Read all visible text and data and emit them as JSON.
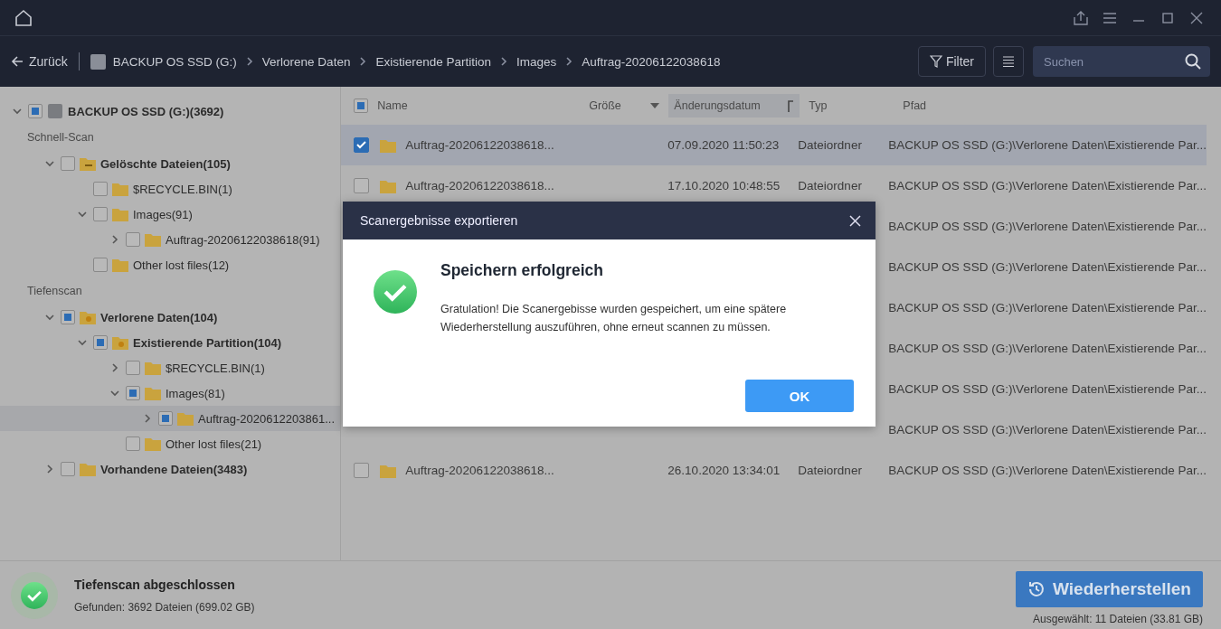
{
  "breadcrumb": {
    "back": "Zurück",
    "crumbs": [
      "BACKUP OS SSD (G:)",
      "Verlorene Daten",
      "Existierende Partition",
      "Images",
      "Auftrag-20206122038618"
    ]
  },
  "toolbar": {
    "filter": "Filter",
    "search": {
      "placeholder": "Suchen"
    }
  },
  "tree": {
    "root": {
      "label": "BACKUP OS SSD (G:)(3692)",
      "partial": true,
      "expandable": true,
      "expanded": true,
      "kind": "drive",
      "bold": true,
      "selected": false
    },
    "sections": [
      {
        "label": "Schnell-Scan",
        "items": [
          {
            "label": "Gelöschte Dateien(105)",
            "partial": false,
            "expandable": true,
            "expanded": true,
            "kind": "deleted",
            "bold": true,
            "selected": false,
            "children": [
              {
                "label": "$RECYCLE.BIN(1)",
                "partial": false,
                "expandable": false,
                "kind": "folder",
                "bold": false,
                "selected": false
              },
              {
                "label": "Images(91)",
                "partial": false,
                "expandable": true,
                "expanded": true,
                "kind": "folder",
                "bold": false,
                "selected": false,
                "children": [
                  {
                    "label": "Auftrag-20206122038618(91)",
                    "partial": false,
                    "expandable": true,
                    "expanded": false,
                    "kind": "folder",
                    "bold": false,
                    "selected": false
                  }
                ]
              },
              {
                "label": "Other lost files(12)",
                "partial": false,
                "expandable": false,
                "kind": "folder",
                "bold": false,
                "selected": false
              }
            ]
          }
        ]
      },
      {
        "label": "Tiefenscan",
        "items": [
          {
            "label": "Verlorene Daten(104)",
            "partial": true,
            "expandable": true,
            "expanded": true,
            "kind": "lost",
            "bold": true,
            "selected": false,
            "children": [
              {
                "label": "Existierende Partition(104)",
                "partial": true,
                "expandable": true,
                "expanded": true,
                "kind": "lost",
                "bold": true,
                "selected": false,
                "children": [
                  {
                    "label": "$RECYCLE.BIN(1)",
                    "partial": false,
                    "expandable": true,
                    "expanded": false,
                    "kind": "folder",
                    "bold": false,
                    "selected": false
                  },
                  {
                    "label": "Images(81)",
                    "partial": true,
                    "expandable": true,
                    "expanded": true,
                    "kind": "folder",
                    "bold": false,
                    "selected": false,
                    "children": [
                      {
                        "label": "Auftrag-2020612203861...",
                        "partial": true,
                        "expandable": true,
                        "expanded": false,
                        "kind": "folder",
                        "bold": false,
                        "selected": true
                      }
                    ]
                  },
                  {
                    "label": "Other lost files(21)",
                    "partial": false,
                    "expandable": false,
                    "kind": "folder",
                    "bold": false,
                    "selected": false
                  }
                ]
              }
            ]
          },
          {
            "label": "Vorhandene Dateien(3483)",
            "partial": false,
            "expandable": true,
            "expanded": false,
            "kind": "folder",
            "bold": true,
            "selected": false
          }
        ]
      }
    ]
  },
  "table": {
    "all_partial": true,
    "columns": [
      {
        "label": "Name",
        "sorted": false,
        "caret": false
      },
      {
        "label": "Größe",
        "sorted": false,
        "caret": true
      },
      {
        "label": "Änderungsdatum",
        "sorted": true,
        "caret": false
      },
      {
        "label": "Typ",
        "sorted": false,
        "caret": false
      },
      {
        "label": "Pfad",
        "sorted": false,
        "caret": false
      }
    ],
    "rows": [
      {
        "kind": "full",
        "name": "Auftrag-20206122038618...",
        "date": "07.09.2020 11:50:23",
        "type": "Dateiordner",
        "path": "BACKUP OS SSD (G:)\\Verlorene Daten\\Existierende Par...",
        "checked": true,
        "selected": true
      },
      {
        "kind": "full",
        "name": "Auftrag-20206122038618...",
        "date": "17.10.2020 10:48:55",
        "type": "Dateiordner",
        "path": "BACKUP OS SSD (G:)\\Verlorene Daten\\Existierende Par...",
        "checked": false,
        "selected": false
      },
      {
        "kind": "path_only",
        "path": "BACKUP OS SSD (G:)\\Verlorene Daten\\Existierende Par..."
      },
      {
        "kind": "path_only",
        "path": "BACKUP OS SSD (G:)\\Verlorene Daten\\Existierende Par..."
      },
      {
        "kind": "path_only",
        "path": "BACKUP OS SSD (G:)\\Verlorene Daten\\Existierende Par..."
      },
      {
        "kind": "path_only",
        "path": "BACKUP OS SSD (G:)\\Verlorene Daten\\Existierende Par..."
      },
      {
        "kind": "path_only",
        "path": "BACKUP OS SSD (G:)\\Verlorene Daten\\Existierende Par..."
      },
      {
        "kind": "path_only",
        "path": "BACKUP OS SSD (G:)\\Verlorene Daten\\Existierende Par..."
      },
      {
        "kind": "full",
        "name": "Auftrag-20206122038618...",
        "date": "26.10.2020 13:34:01",
        "type": "Dateiordner",
        "path": "BACKUP OS SSD (G:)\\Verlorene Daten\\Existierende Par...",
        "checked": false,
        "selected": false
      }
    ]
  },
  "status": {
    "title": "Tiefenscan abgeschlossen",
    "detail": "Gefunden: 3692 Dateien (699.02 GB)",
    "recover": "Wiederherstellen",
    "selection": "Ausgewählt: 11 Dateien (33.81 GB)"
  },
  "dialog": {
    "title": "Scanergebnisse exportieren",
    "heading": "Speichern erfolgreich",
    "message": "Gratulation! Die Scanergebisse wurden gespeichert, um eine spätere Wiederherstellung auszuführen, ohne erneut scannen zu müssen.",
    "ok": "OK"
  }
}
